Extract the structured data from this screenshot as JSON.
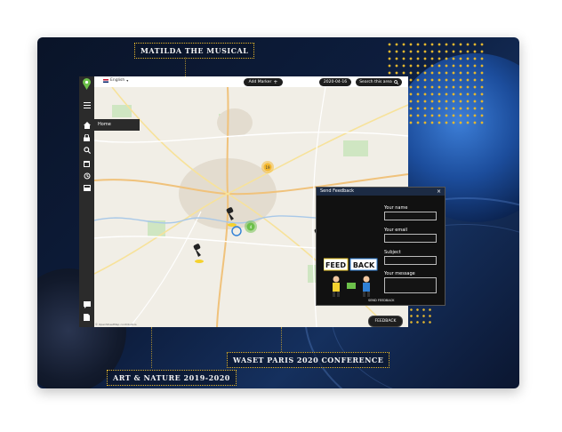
{
  "labels": {
    "top": "MATILDA THE MUSICAL",
    "left_bottom": "ART & NATURE 2019-2020",
    "right_bottom": "WASET PARIS 2020 CONFERENCE"
  },
  "topbar": {
    "language": "English",
    "add_marker": "Add Marker",
    "date": "2020-04-16",
    "search_area": "Search this area",
    "help": "?"
  },
  "sidebar": {
    "menu_item": "Home"
  },
  "map": {
    "attribution": "© OpenStreetMap contributors",
    "cluster_top": "19",
    "cluster_center": "4"
  },
  "feedback": {
    "title": "Send Feedback",
    "close": "×",
    "fields": {
      "name": "Your name",
      "email": "Your email",
      "subject": "Subject",
      "message": "Your message"
    },
    "illustration_words": [
      "FEED",
      "BACK"
    ],
    "send_label": "SEND FEEDBACK",
    "button_label": "FEEDBACK"
  },
  "colors": {
    "accent_gold": "#e5b72e",
    "cluster_orange": "#f5b82e",
    "cluster_green": "#6cc04a",
    "dark_ui": "#1e1e1e"
  }
}
